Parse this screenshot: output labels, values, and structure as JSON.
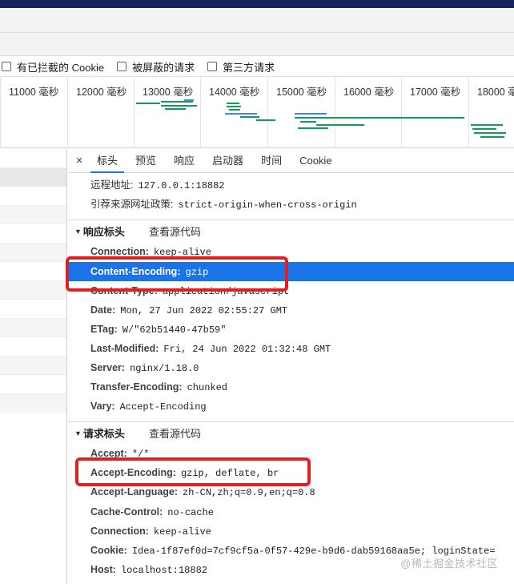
{
  "filters": [
    {
      "label": "有已拦截的 Cookie"
    },
    {
      "label": "被屏蔽的请求"
    },
    {
      "label": "第三方请求"
    }
  ],
  "timeline": {
    "ticks": [
      "11000 毫秒",
      "12000 毫秒",
      "13000 毫秒",
      "14000 毫秒",
      "15000 毫秒",
      "16000 毫秒",
      "17000 毫秒",
      "18000 毫秒"
    ]
  },
  "tabs": {
    "close": "×",
    "items": [
      "标头",
      "预览",
      "响应",
      "启动器",
      "时间",
      "Cookie"
    ],
    "active": "标头"
  },
  "general": [
    {
      "key": "远程地址:",
      "value": "127.0.0.1:18882"
    },
    {
      "key": "引荐来源网址政策:",
      "value": "strict-origin-when-cross-origin"
    }
  ],
  "response_section": {
    "title": "响应标头",
    "view_source": "查看源代码"
  },
  "response_headers": [
    {
      "key": "Connection:",
      "value": "keep-alive"
    },
    {
      "key": "Content-Encoding:",
      "value": "gzip"
    },
    {
      "key": "Content-Type:",
      "value": "application/javascript"
    },
    {
      "key": "Date:",
      "value": "Mon, 27 Jun 2022 02:55:27 GMT"
    },
    {
      "key": "ETag:",
      "value": "W/\"62b51440-47b59\""
    },
    {
      "key": "Last-Modified:",
      "value": "Fri, 24 Jun 2022 01:32:48 GMT"
    },
    {
      "key": "Server:",
      "value": "nginx/1.18.0"
    },
    {
      "key": "Transfer-Encoding:",
      "value": "chunked"
    },
    {
      "key": "Vary:",
      "value": "Accept-Encoding"
    }
  ],
  "request_section": {
    "title": "请求标头",
    "view_source": "查看源代码"
  },
  "request_headers": [
    {
      "key": "Accept:",
      "value": "*/*"
    },
    {
      "key": "Accept-Encoding:",
      "value": "gzip, deflate, br"
    },
    {
      "key": "Accept-Language:",
      "value": "zh-CN,zh;q=0.9,en;q=0.8"
    },
    {
      "key": "Cache-Control:",
      "value": "no-cache"
    },
    {
      "key": "Connection:",
      "value": "keep-alive"
    },
    {
      "key": "Cookie:",
      "value": "Idea-1f87ef0d=7cf9cf5a-0f57-429e-b9d6-dab59168aa5e; loginState="
    },
    {
      "key": "Host:",
      "value": "localhost:18882"
    }
  ],
  "watermark": "@稀土掘金技术社区",
  "colors": {
    "selection": "#1a73e8",
    "annotation": "#e02020",
    "waterfall_green": "#0f9d58",
    "waterfall_blue": "#4285f4"
  }
}
